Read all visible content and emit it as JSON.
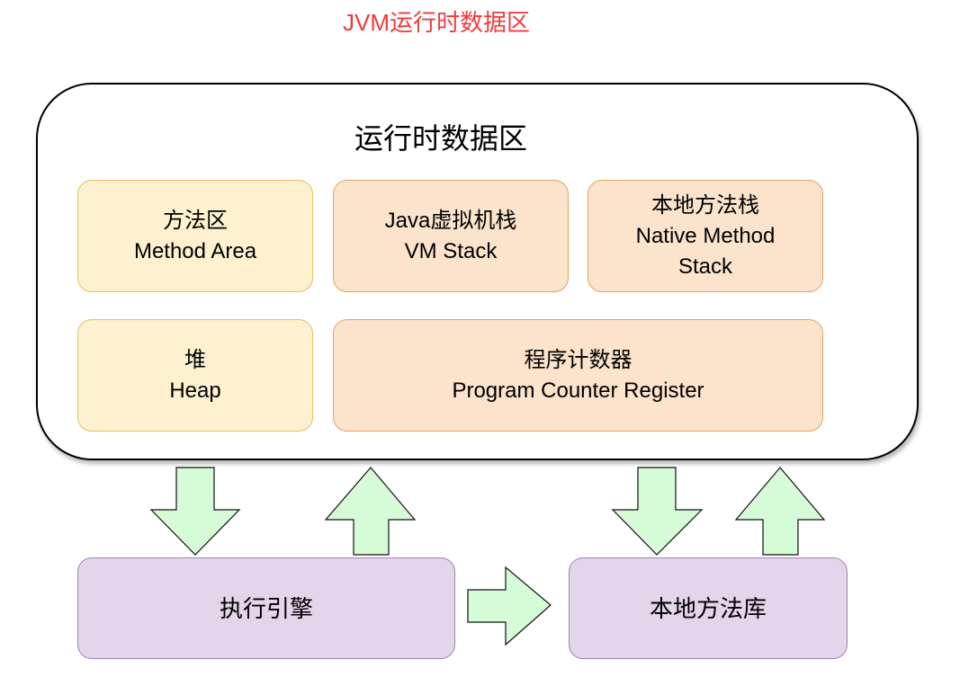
{
  "title": "JVM运行时数据区",
  "container": {
    "title": "运行时数据区"
  },
  "areas": {
    "method_area": {
      "line1": "方法区",
      "line2": "Method Area"
    },
    "vm_stack": {
      "line1": "Java虚拟机栈",
      "line2": "VM Stack"
    },
    "native_stack": {
      "line1": "本地方法栈",
      "line2": "Native Method",
      "line3": "Stack"
    },
    "heap": {
      "line1": "堆",
      "line2": "Heap"
    },
    "pc_register": {
      "line1": "程序计数器",
      "line2": "Program Counter Register"
    }
  },
  "bottom": {
    "execution_engine": "执行引擎",
    "native_library": "本地方法库"
  },
  "colors": {
    "title_red": "#f23a3a",
    "yellow_fill": "#fdf1d0",
    "orange_fill": "#fbe3cc",
    "purple_fill": "#e3d5ea",
    "arrow_fill": "#d5fcd6"
  }
}
